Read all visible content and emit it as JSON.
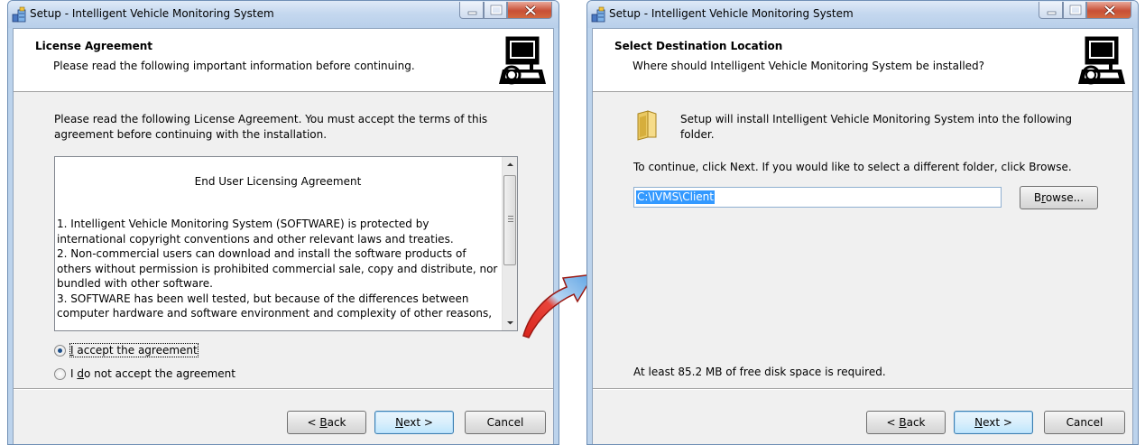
{
  "left_window": {
    "title": "Setup - Intelligent Vehicle Monitoring System",
    "header_title": "License Agreement",
    "header_subtitle": "Please read the following important information before continuing.",
    "intro_line1": "Please read the following License Agreement. You must accept the terms of this",
    "intro_line2": "agreement before continuing with the installation.",
    "license_heading": "End User Licensing Agreement",
    "license_lines": [
      "1. Intelligent Vehicle Monitoring System (SOFTWARE) is protected by",
      "international copyright conventions and other relevant laws and treaties.",
      "2. Non-commercial users can download and install the software products of",
      "others without permission is prohibited commercial sale, copy and distribute, nor",
      "bundled with other software.",
      "3. SOFTWARE has been well tested, but because of the differences between",
      "computer hardware and software environment and complexity of other reasons,"
    ],
    "radio_accept": {
      "prefix": "",
      "mnemonic": "I",
      "rest": " accept the agreement",
      "selected": true
    },
    "radio_decline": {
      "prefix": "I ",
      "mnemonic": "d",
      "rest": "o not accept the agreement",
      "selected": false
    },
    "back_button": {
      "prefix": "< ",
      "mnemonic": "B",
      "rest": "ack"
    },
    "next_button": {
      "prefix": "",
      "mnemonic": "N",
      "rest": "ext >"
    },
    "cancel_button": "Cancel"
  },
  "right_window": {
    "title": "Setup - Intelligent Vehicle Monitoring System",
    "header_title": "Select Destination Location",
    "header_subtitle": "Where should Intelligent Vehicle Monitoring System be installed?",
    "install_line1": "Setup will install Intelligent Vehicle Monitoring System into the following",
    "install_line2": "folder.",
    "continue_text": "To continue, click Next. If you would like to select a different folder, click Browse.",
    "install_path": "C:\\IVMS\\Client",
    "browse_button": {
      "prefix": "B",
      "mnemonic": "r",
      "rest": "owse..."
    },
    "disk_space": "At least 85.2 MB of free disk space is required.",
    "back_button": {
      "prefix": "< ",
      "mnemonic": "B",
      "rest": "ack"
    },
    "next_button": {
      "prefix": "",
      "mnemonic": "N",
      "rest": "ext >"
    },
    "cancel_button": "Cancel"
  },
  "colors": {
    "titlebar": "#c5d8ef",
    "client_bg": "#f0f0f0",
    "selection": "#3399ff",
    "arrow_red": "#d9241c",
    "arrow_blue": "#6aaee8"
  }
}
